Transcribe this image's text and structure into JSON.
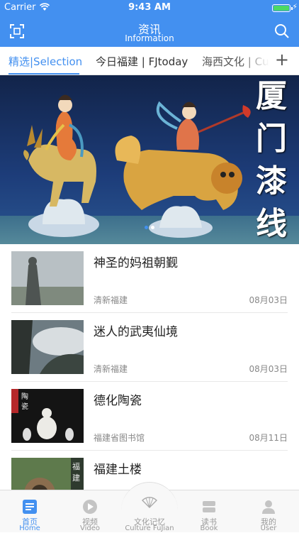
{
  "status_bar": {
    "carrier": "Carrier",
    "time": "9:43 AM"
  },
  "nav": {
    "title": "资讯",
    "subtitle": "Information"
  },
  "tabs": [
    {
      "label": "精选|Selection",
      "active": true
    },
    {
      "label": "今日福建 | FJtoday",
      "active": false
    },
    {
      "label": "海西文化 | Cu",
      "active": false
    }
  ],
  "banner": {
    "caption": "厦门漆线雕",
    "page_count": 2,
    "current_page": 1
  },
  "news": [
    {
      "title": "神圣的妈祖朝觐",
      "source": "清新福建",
      "date": "08月03日"
    },
    {
      "title": "迷人的武夷仙境",
      "source": "清新福建",
      "date": "08月03日"
    },
    {
      "title": "德化陶瓷",
      "source": "福建省图书馆",
      "date": "08月11日"
    },
    {
      "title": "福建土楼",
      "source": "",
      "date": ""
    }
  ],
  "tabbar": [
    {
      "label": "首页",
      "sub": "Home",
      "icon": "home-icon",
      "active": true
    },
    {
      "label": "视频",
      "sub": "Video",
      "icon": "video-icon",
      "active": false
    },
    {
      "label": "文化记忆",
      "sub": "Culture FuJian",
      "icon": "fan-icon",
      "active": false
    },
    {
      "label": "读书",
      "sub": "Book",
      "icon": "book-icon",
      "active": false
    },
    {
      "label": "我的",
      "sub": "User",
      "icon": "user-icon",
      "active": false
    }
  ],
  "colors": {
    "accent": "#4390f0",
    "battery": "#4cd964"
  }
}
